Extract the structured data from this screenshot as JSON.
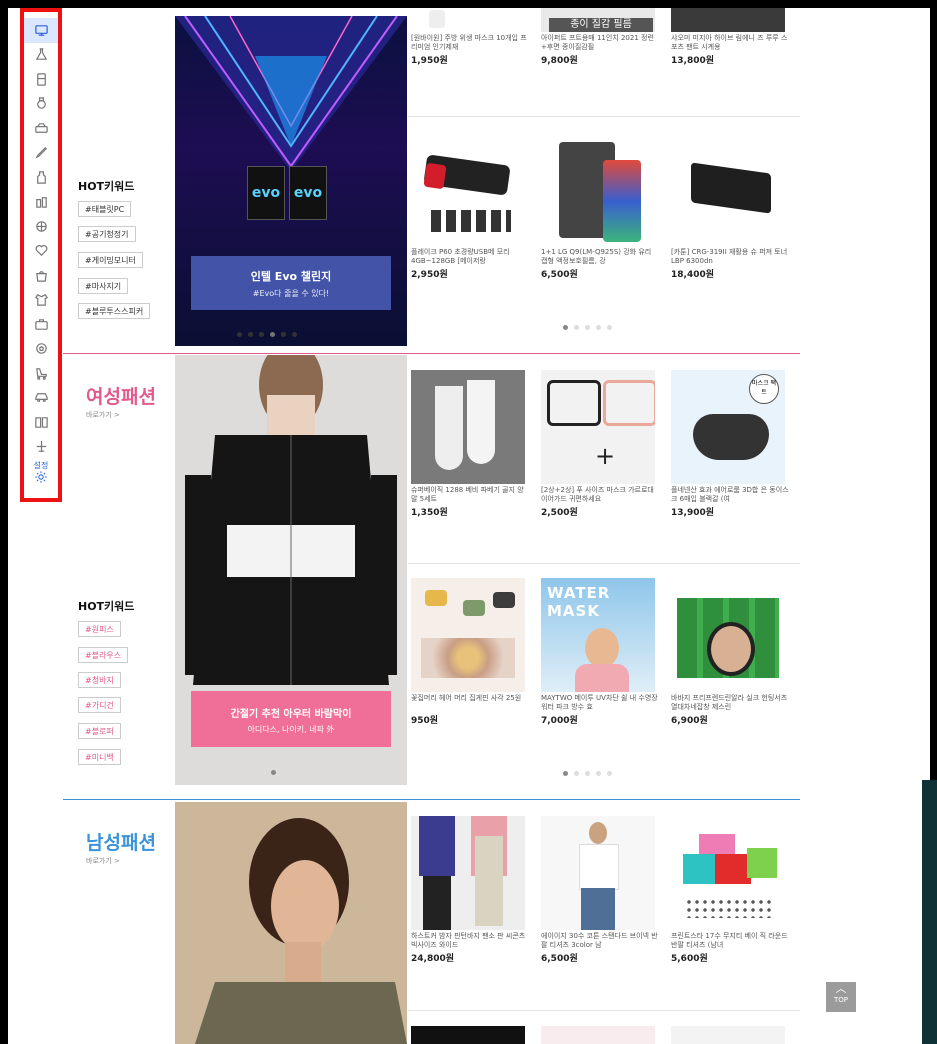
{
  "sidebar": {
    "icons": [
      "monitor-icon",
      "flask-icon",
      "fridge-icon",
      "watch-icon",
      "car-icon",
      "pencil-icon",
      "bottle-icon",
      "cosmetics-icon",
      "ball-icon",
      "heart-icon",
      "handbag-icon",
      "baby-clothes-icon",
      "toolbox-icon",
      "soccer-icon",
      "stroller-icon",
      "car2-icon",
      "book-icon",
      "airplane-icon"
    ],
    "settings_label": "설정"
  },
  "section1": {
    "hot_title": "HOT키워드",
    "tags": [
      "#태블릿PC",
      "#공기청정기",
      "#게이밍모니터",
      "#마사지기",
      "#블루투스스피커"
    ],
    "banner_title": "인텔 Evo 챌린지",
    "banner_sub": "#Evo다 줄을 수 있다!",
    "products_top": [
      {
        "name": "[원바이원] 주방 위생 마스크 10개입 프리미엄 인기제재",
        "price": "1,950원"
      },
      {
        "name": "아이퍼트 프트용매 11인치 2021 정련+후면 종이질감필",
        "price": "9,800원",
        "img_text": "종이 질감 필름"
      },
      {
        "name": "샤오미 미지아 하이브 림에니 즈 루루 스포츠 팬트 시계용",
        "price": "13,800원"
      }
    ],
    "products_bottom": [
      {
        "name": "플레이크 P60 초경량USB메 모리 4GB~128GB [메이저랑",
        "price": "2,950원"
      },
      {
        "name": "1+1 LG Q9(LM-Q925S) 강화 유리 캡형 액정보호필름, 강",
        "price": "6,500원"
      },
      {
        "name": "[카툰] CRG-319II 재활용 슈 퍼져 토너 LBP 6300dn",
        "price": "18,400원"
      }
    ]
  },
  "women": {
    "title": "여성패션",
    "more": "바로가기 >",
    "hot_title": "HOT키워드",
    "tags": [
      "#원피스",
      "#블라우스",
      "#청바지",
      "#가디건",
      "#블로퍼",
      "#미니백"
    ],
    "banner_title": "간절기 추천 아우터 바람막이",
    "banner_sub": "아디다스, 나이키, 네파 外",
    "products_top": [
      {
        "name": "슈퍼베이직 1288 베비 파베기 골지 양말 5세트",
        "price": "1,350원"
      },
      {
        "name": "[2상+2상] 푸 사이즈 마스크 가르로대 이어가드 귀편하세요",
        "price": "2,500원"
      },
      {
        "name": "플네넨산 효과 에어로룸 3D합 은 동이스크 6매입 블랙갈 (여",
        "price": "13,900원",
        "img_text": "마스크 팩트"
      }
    ],
    "products_bottom": [
      {
        "name": "꽃집머리 헤어 머리 집게핀 사각 25원",
        "price": "950원"
      },
      {
        "name": "MAYTWO 메이투 UV차단 쉴 내 수영장 워터 파크 방수 효",
        "price": "7,000원",
        "img_text": "WATER MASK"
      },
      {
        "name": "바바지 프리프렌드린알라 실크 헌팅서츠 열대차네잡창 제스린",
        "price": "6,900원"
      }
    ]
  },
  "men": {
    "title": "남성패션",
    "more": "바로가기 >",
    "products_top": [
      {
        "name": "하스트커 밤자 핀턴바지 팬소 판 씨콘츠 빅사이즈 와이드",
        "price": "24,800원"
      },
      {
        "name": "에이이지 30수 코튼 스탠다드 브이넥 반팔 티셔츠 3color 남",
        "price": "6,500원"
      },
      {
        "name": "프린트스타 17수 무지티 베이 직 라운드 반팔 티셔츠 (남녀",
        "price": "5,600원"
      }
    ]
  },
  "top_button": "TOP",
  "colors": {
    "accent_blue": "#2d63d8",
    "women_pink": "#e25a8c",
    "men_blue": "#3a93d8",
    "highlight_red": "#ee1111"
  }
}
